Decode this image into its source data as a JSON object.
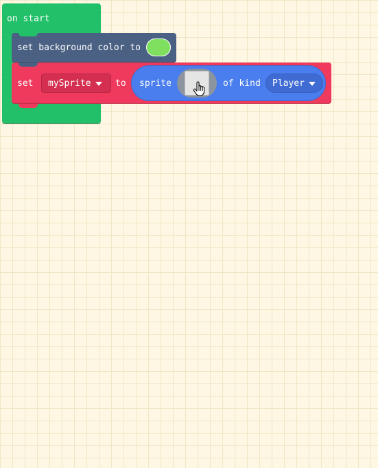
{
  "workspace": {
    "background_color": "#fdf7e4",
    "grid_color": "#efe7c6"
  },
  "on_start": {
    "label": "on start",
    "color": "#23c06a"
  },
  "set_background": {
    "label": "set background color to",
    "color": "#4b6183",
    "swatch_color": "#7fe05f"
  },
  "set_sprite": {
    "set_label": "set",
    "variable": "mySprite",
    "to_label": "to",
    "color": "#ef3a5d",
    "reporter": {
      "sprite_label": "sprite",
      "of_kind_label": "of kind",
      "kind": "Player",
      "color": "#4a7ded"
    }
  },
  "icons": {
    "caret": "chevron-down-icon",
    "hand": "hand-pointer-icon"
  }
}
